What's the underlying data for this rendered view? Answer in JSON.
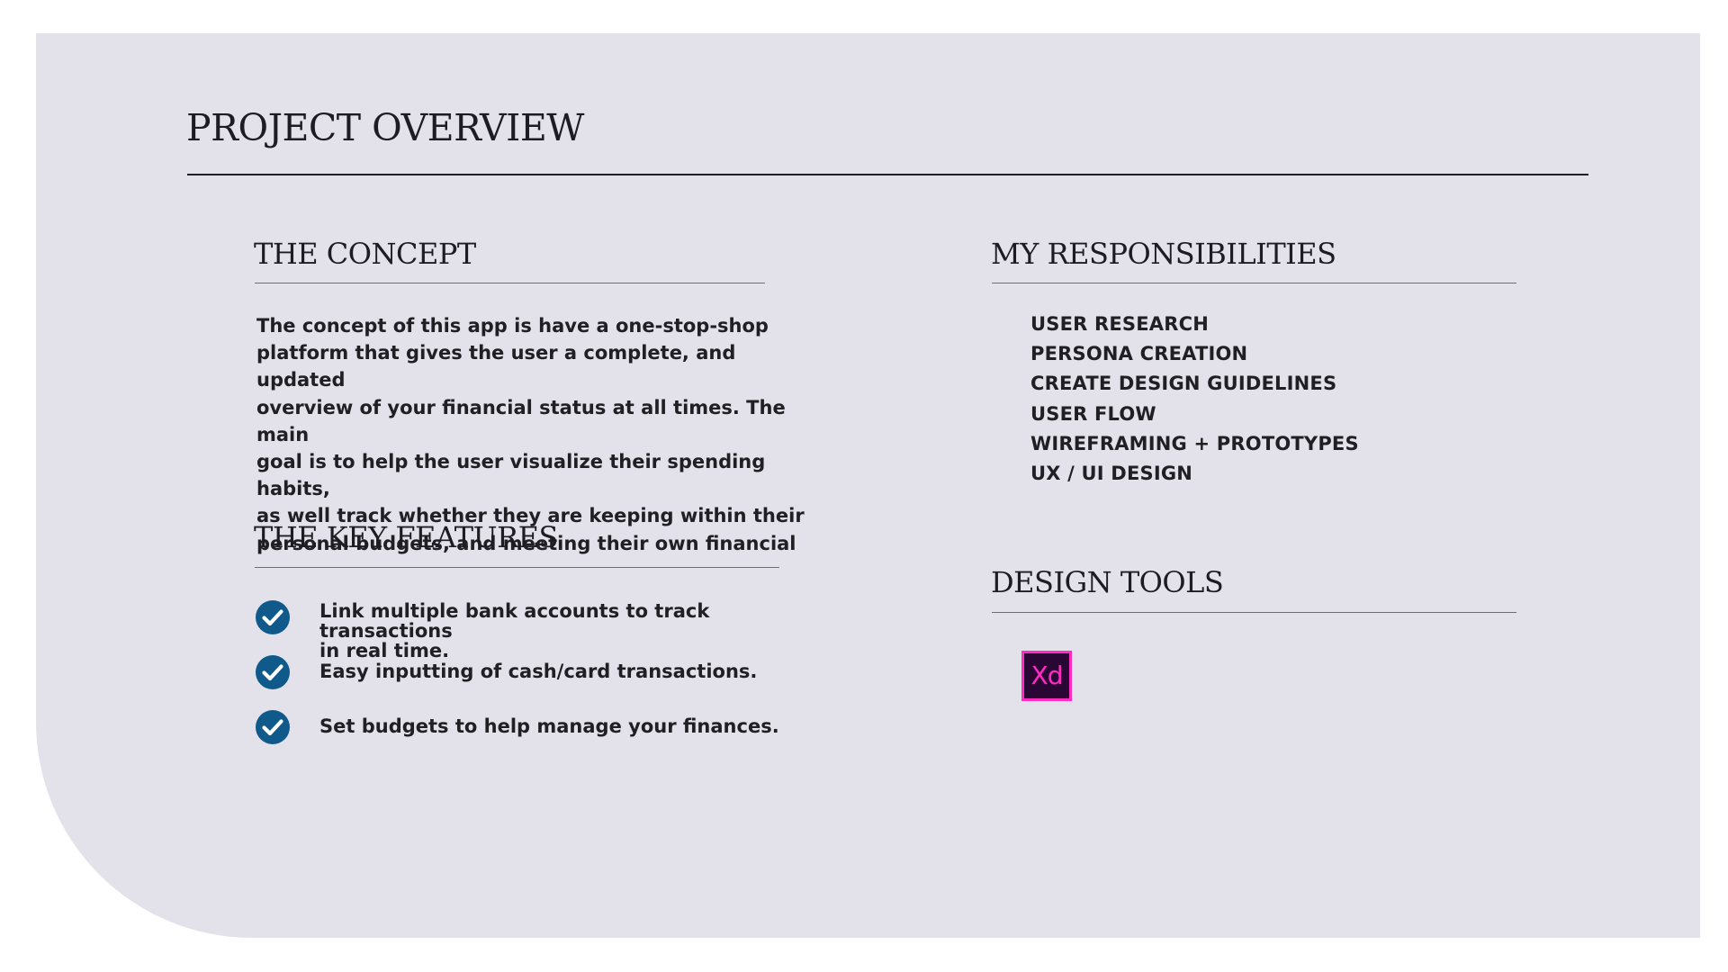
{
  "page": {
    "title": "PROJECT OVERVIEW"
  },
  "concept": {
    "heading": "THE CONCEPT",
    "lines": [
      "The concept of this app is have a one-stop-shop",
      "platform that gives the user a complete, and updated",
      "overview of your financial status at all times. The main",
      "goal is  to help the user visualize their spending habits,",
      "as well track whether they are keeping within their",
      "personal budgets, and meeting their own financial"
    ]
  },
  "key_features": {
    "heading": "THE KEY FEATURES",
    "items": [
      {
        "icon": "checkmark-circle-icon",
        "lines": [
          "Link multiple bank accounts to track transactions",
          "in real time."
        ]
      },
      {
        "icon": "checkmark-circle-icon",
        "lines": [
          "Easy inputting of cash/card transactions."
        ]
      },
      {
        "icon": "checkmark-circle-icon",
        "lines": [
          "Set budgets to help manage your finances."
        ]
      }
    ]
  },
  "responsibilities": {
    "heading": "MY RESPONSIBILITIES",
    "items": [
      "USER RESEARCH",
      "PERSONA CREATION",
      "CREATE DESIGN GUIDELINES",
      "USER FLOW",
      "WIREFRAMING + PROTOTYPES",
      "UX / UI DESIGN"
    ]
  },
  "design_tools": {
    "heading": "DESIGN TOOLS",
    "tools": [
      {
        "icon": "adobe-xd-logo-icon",
        "label": "Xd"
      }
    ]
  },
  "colors": {
    "panel_background": "#e3e1e9",
    "check_icon": "#0f5a8a",
    "xd_background": "#2a0634",
    "xd_accent": "#ff2bc2",
    "text": "#1f1f24"
  }
}
